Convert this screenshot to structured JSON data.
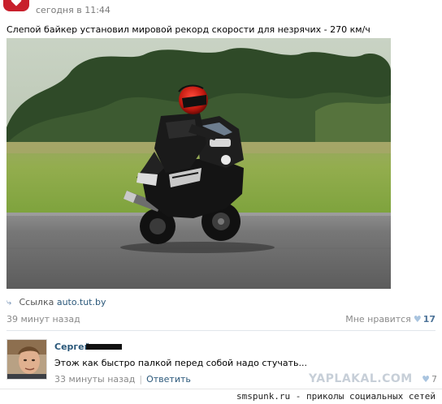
{
  "post": {
    "time": "сегодня в 11:44",
    "text": "Слепой байкер установил мировой рекорд скорости для незрячих - 270 км/ч",
    "link_prefix": "Ссылка",
    "link_domain": "auto.tut.by",
    "age": "39 минут назад",
    "like_label": "Мне нравится",
    "like_count": "17"
  },
  "comment": {
    "author": "Сергей",
    "text": "Этож как быстро палкой перед собой надо стучать...",
    "age": "33 минуты назад",
    "reply_label": "Ответить",
    "like_count": "7"
  },
  "watermark": "YAPLAKAL.COM",
  "footer": "smspunk.ru - приколы социальных сетей",
  "colors": {
    "link": "#2b587a",
    "muted": "#8a8a8a",
    "brand_red": "#c8202c",
    "like_heart": "#a9c4df"
  },
  "icons": {
    "brand": "heart-logo-icon",
    "link": "link-arrow-icon",
    "like": "heart-icon"
  }
}
